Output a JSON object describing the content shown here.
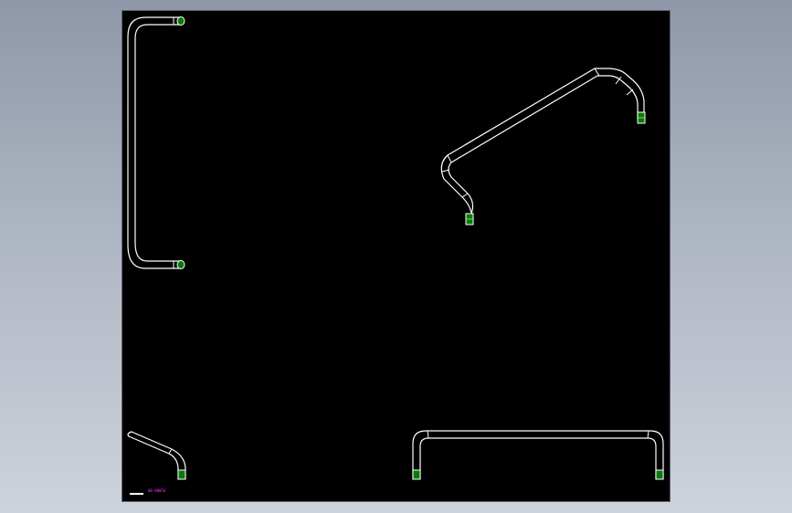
{
  "window": {
    "background": "#a3abb9"
  },
  "sheet": {
    "background": "#000000",
    "line_color": "#ffffff",
    "end_cap_color": "#0b7a0b"
  },
  "views": [
    {
      "name": "bracket-handle-view",
      "type": "pipe"
    },
    {
      "name": "angled-pipe-view",
      "type": "pipe"
    },
    {
      "name": "short-bent-pipe-view",
      "type": "pipe"
    },
    {
      "name": "u-handle-view",
      "type": "pipe"
    }
  ],
  "annotation": {
    "scale_label": "00-00054",
    "color": "#ff33ff"
  }
}
